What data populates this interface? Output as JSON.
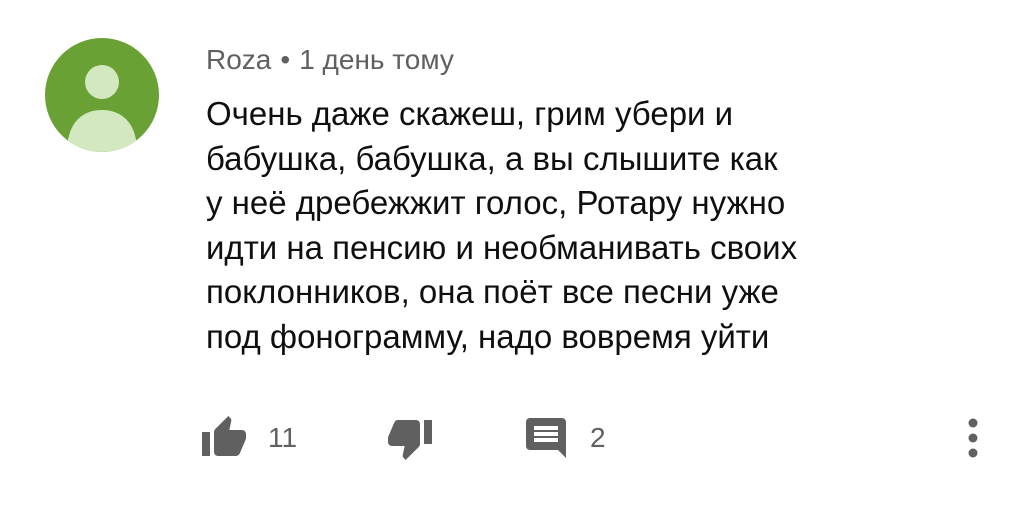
{
  "comment": {
    "author": "Roza",
    "separator": "•",
    "time": "1 день тому",
    "text": "Очень даже скажеш, грим убери и\nбабушка, бабушка, а вы слышите как\nу неё дребежжит голос, Ротару нужно\nидти на пенсию и необманивать своих\nпоклонников, она поёт все песни уже\nпод фонограмму, надо вовремя уйти",
    "likes": "11",
    "replies": "2",
    "avatar_color": "#6aa135",
    "avatar_figure_color": "#d3e8bf",
    "icon_color": "#606060",
    "icons": {
      "like": "thumb-up-icon",
      "dislike": "thumb-down-icon",
      "reply": "comment-icon",
      "more": "more-vert-icon"
    }
  }
}
